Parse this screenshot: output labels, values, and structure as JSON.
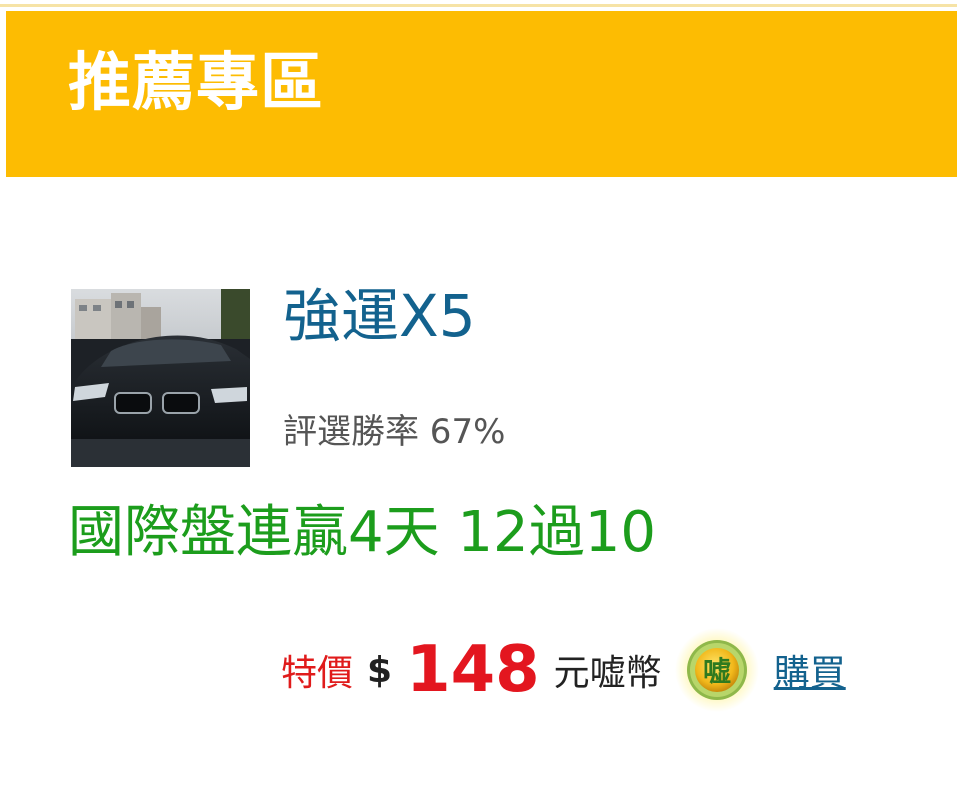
{
  "header": {
    "title": "推薦專區"
  },
  "product": {
    "name": "強運X5",
    "win_rate": "評選勝率 67%",
    "promo": "國際盤連贏4天 12過10",
    "thumbnail_icon": "car-photo"
  },
  "price": {
    "special_label": "特價",
    "currency_symbol": "$",
    "amount": "148",
    "unit": "元嘘幣",
    "coin_icon": "coin-icon",
    "coin_glyph": "嘘",
    "buy_label": "購買"
  },
  "colors": {
    "header_bg": "#fdbc02",
    "product_name": "#13628e",
    "promo": "#1c9d1c",
    "price": "#e3161f",
    "link": "#13628e"
  }
}
